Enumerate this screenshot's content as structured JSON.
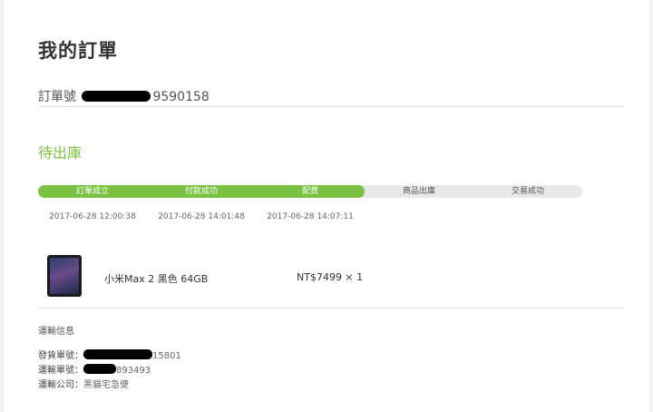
{
  "page_title": "我的訂單",
  "order": {
    "label": "訂單號",
    "number_suffix": "9590158"
  },
  "status": "待出庫",
  "progress": {
    "completed_steps": 3,
    "total_steps": 5,
    "steps": [
      {
        "label": "訂單成立",
        "time": "2017-06-28 12:00:38"
      },
      {
        "label": "付款成功",
        "time": "2017-06-28 14:01:48"
      },
      {
        "label": "配貨",
        "time": "2017-06-28 14:07:11"
      },
      {
        "label": "商品出庫",
        "time": ""
      },
      {
        "label": "交易成功",
        "time": ""
      }
    ]
  },
  "product": {
    "name": "小米Max 2 黑色 64GB",
    "price": "NT$7499 × 1"
  },
  "shipping": {
    "title": "運輸信息",
    "rows": [
      {
        "label": "發貨單號：",
        "value_suffix": "15801"
      },
      {
        "label": "運輸單號：",
        "value_suffix": "893493"
      },
      {
        "label": "運輸公司：",
        "value_suffix": "黑貓宅急便"
      }
    ]
  },
  "colors": {
    "accent": "#7cc242",
    "track": "#e8e8e8"
  }
}
